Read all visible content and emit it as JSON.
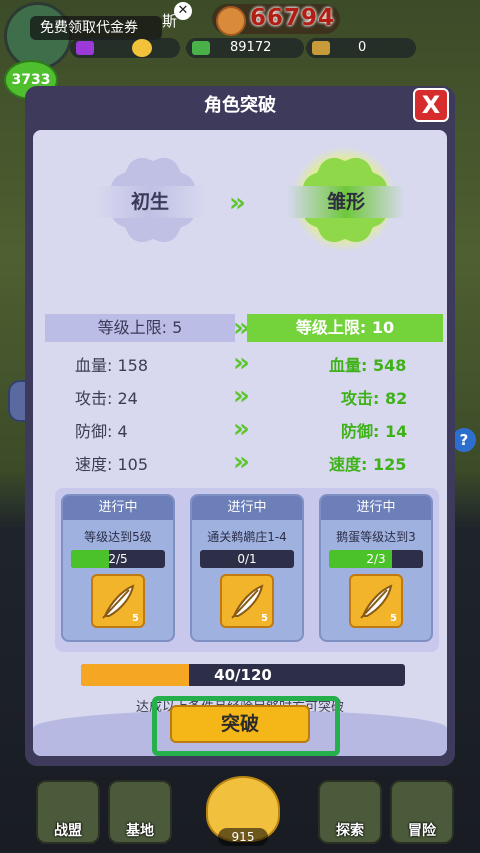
{
  "hud": {
    "promo_text": "免费领取代金券",
    "promo_close": "✕",
    "name_fragment": "斯",
    "coin_value": "66794",
    "currency_2": "89172",
    "currency_3": "0",
    "level_badge": "3733"
  },
  "modal": {
    "title": "角色突破",
    "close_label": "X",
    "current_rank": "初生",
    "next_rank": "雏形",
    "arrow": "»",
    "level_cap_current": "等级上限: 5",
    "level_cap_next": "等级上限: 10",
    "stats": [
      {
        "current": "血量: 158",
        "next": "血量: 548"
      },
      {
        "current": "攻击: 24",
        "next": "攻击: 82"
      },
      {
        "current": "防御: 4",
        "next": "防御: 14"
      },
      {
        "current": "速度: 105",
        "next": "速度: 125"
      }
    ],
    "tasks": [
      {
        "status": "进行中",
        "desc": "等级达到5级",
        "progress": "2/5",
        "progress_fraction": 0.4,
        "reward_count": "5"
      },
      {
        "status": "进行中",
        "desc": "通关鹈鹕庄1-4",
        "progress": "0/1",
        "progress_fraction": 0.0,
        "reward_count": "5"
      },
      {
        "status": "进行中",
        "desc": "鹅蛋等级达到3",
        "progress": "2/3",
        "progress_fraction": 0.6667,
        "reward_count": "5"
      }
    ],
    "exp_text": "40/120",
    "exp_fraction": 0.3333,
    "hint": "达成以上条件且经验足够时方可突破",
    "break_button": "突破"
  },
  "nav": {
    "alliance": "战盟",
    "base": "基地",
    "egg_count": "915",
    "explore": "探索",
    "adventure": "冒险"
  },
  "colors": {
    "accent_green": "#5bc72a",
    "stat_green": "#3fb21a",
    "break_button": "#f5b718",
    "close_red": "#d62c2c",
    "highlight_outline": "#25b04b"
  }
}
